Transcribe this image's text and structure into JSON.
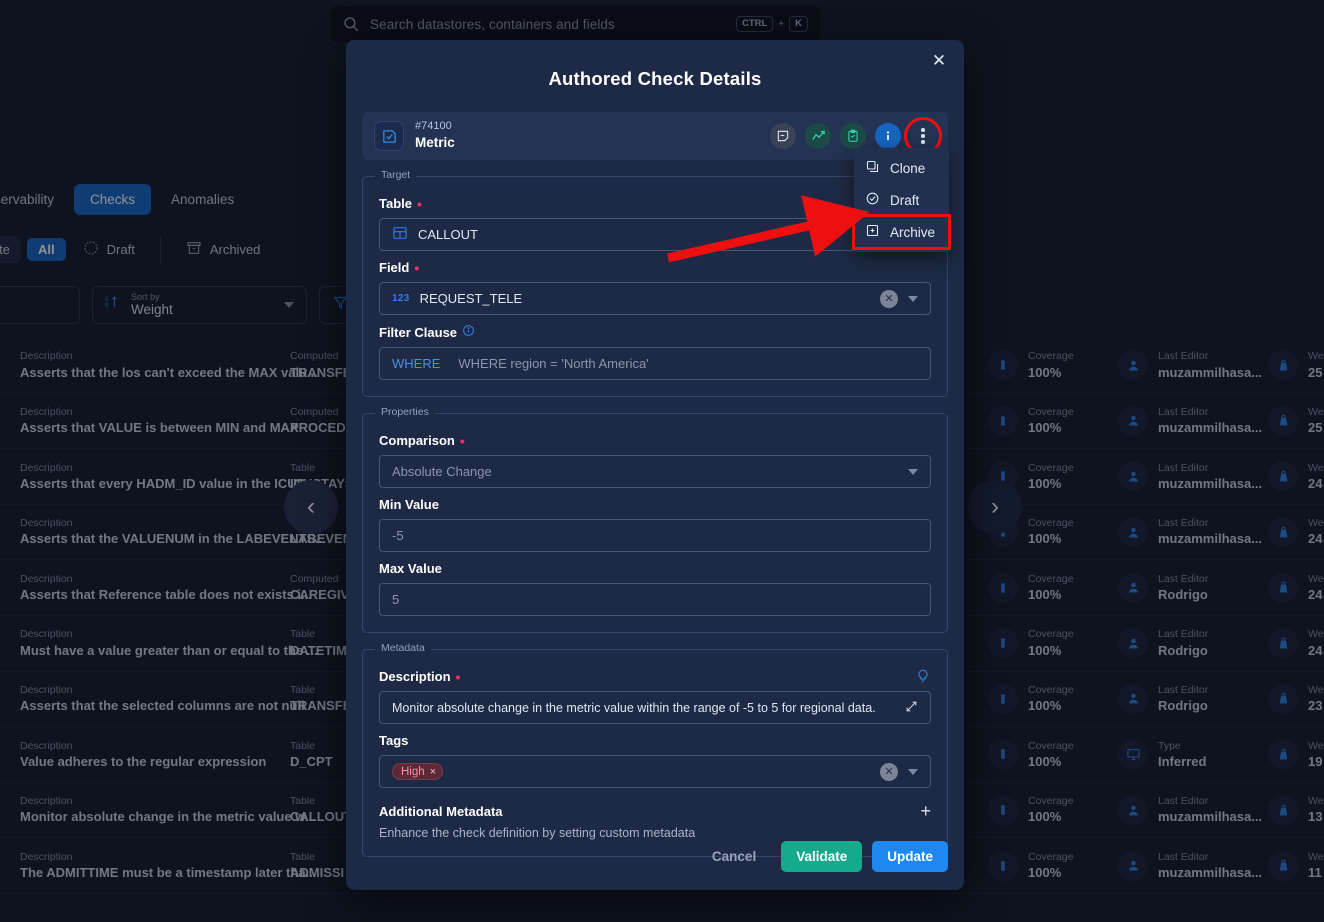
{
  "topbar": {
    "search_placeholder": "Search datastores, containers and fields",
    "kbd_ctrl": "CTRL",
    "kbd_plus": "+",
    "kbd_key": "K"
  },
  "nav": {
    "tabs": [
      {
        "label": "Observability",
        "active": false
      },
      {
        "label": "Checks",
        "active": true
      },
      {
        "label": "Anomalies",
        "active": false
      }
    ]
  },
  "filters": {
    "favorite": "avorite",
    "all": "All",
    "draft": "Draft",
    "archived": "Archived"
  },
  "controls": {
    "sort_label": "Sort by",
    "sort_value": "Weight"
  },
  "list": {
    "labels": {
      "description": "Description",
      "table": "Table",
      "computed": "Computed",
      "coverage": "Coverage",
      "last_editor": "Last Editor",
      "type": "Type",
      "weight": "Weight"
    },
    "rows": [
      {
        "desc": "Asserts that the los can't exceed the MAX valu...",
        "target_label": "Computed",
        "target": "TRANSFE",
        "coverage": "100%",
        "editor_label": "Last Editor",
        "editor": "muzammilhasa...",
        "editor_icon": "user-icon",
        "weight": "25"
      },
      {
        "desc": "Asserts that VALUE is between MIN and MAX",
        "target_label": "Computed",
        "target": "PROCEDU",
        "coverage": "100%",
        "editor_label": "Last Editor",
        "editor": "muzammilhasa...",
        "editor_icon": "user-icon",
        "weight": "25"
      },
      {
        "desc": "Asserts that every HADM_ID value in the ICUS...",
        "target_label": "Table",
        "target": "ICUSTAYS",
        "coverage": "100%",
        "editor_label": "Last Editor",
        "editor": "muzammilhasa...",
        "editor_icon": "user-icon",
        "weight": "24"
      },
      {
        "desc": "Asserts that the VALUENUM in the LABEVENTS...",
        "target_label": "Table",
        "target": "LABEVEN",
        "coverage": "100%",
        "editor_label": "Last Editor",
        "editor": "muzammilhasa...",
        "editor_icon": "user-icon",
        "weight": "24"
      },
      {
        "desc": "Asserts that Reference table does not exists i...",
        "target_label": "Computed",
        "target": "CAREGIV",
        "coverage": "100%",
        "editor_label": "Last Editor",
        "editor": "Rodrigo",
        "editor_icon": "user-icon",
        "weight": "24"
      },
      {
        "desc": "Must have a value greater than or equal to the ...",
        "target_label": "Table",
        "target": "DATETIM",
        "coverage": "100%",
        "editor_label": "Last Editor",
        "editor": "Rodrigo",
        "editor_icon": "user-icon",
        "weight": "24"
      },
      {
        "desc": "Asserts that the selected columns are not null",
        "target_label": "Table",
        "target": "TRANSFE",
        "coverage": "100%",
        "editor_label": "Last Editor",
        "editor": "Rodrigo",
        "editor_icon": "user-icon",
        "weight": "23"
      },
      {
        "desc": "Value adheres to the regular expression",
        "target_label": "Table",
        "target": "D_CPT",
        "coverage": "100%",
        "editor_label": "Type",
        "editor": "Inferred",
        "editor_icon": "monitor-icon",
        "weight": "19"
      },
      {
        "desc": "Monitor absolute change in the metric value w...",
        "target_label": "Table",
        "target": "CALLOUT",
        "coverage": "100%",
        "editor_label": "Last Editor",
        "editor": "muzammilhasa...",
        "editor_icon": "user-icon",
        "weight": "13"
      },
      {
        "desc": "The ADMITTIME must be a timestamp later tha...",
        "target_label": "Table",
        "target": "ADMISSI",
        "coverage": "100%",
        "editor_label": "Last Editor",
        "editor": "muzammilhasa...",
        "editor_icon": "user-icon",
        "weight": "11"
      }
    ]
  },
  "pager": {
    "prev": "‹",
    "next": "›"
  },
  "modal": {
    "title": "Authored Check Details",
    "close": "✕",
    "check": {
      "id": "#74100",
      "type": "Metric",
      "actions": [
        {
          "name": "note-icon",
          "style": "gray"
        },
        {
          "name": "trend-chart-icon",
          "style": "teal"
        },
        {
          "name": "clipboard-check-icon",
          "style": "teal"
        },
        {
          "name": "info-icon",
          "style": "blue"
        }
      ]
    },
    "dropdown": {
      "items": [
        {
          "label": "Clone",
          "icon": "clone-icon",
          "highlighted": false
        },
        {
          "label": "Draft",
          "icon": "draft-check-icon",
          "highlighted": false
        },
        {
          "label": "Archive",
          "icon": "archive-icon",
          "highlighted": true
        }
      ]
    },
    "target": {
      "legend": "Target",
      "table_label": "Table",
      "table_value": "CALLOUT",
      "field_label": "Field",
      "field_value": "REQUEST_TELE",
      "field_type_icon": "123",
      "filter_label": "Filter Clause",
      "filter_kw": "WHERE",
      "filter_placeholder": "WHERE region = 'North America'"
    },
    "properties": {
      "legend": "Properties",
      "comparison_label": "Comparison",
      "comparison_value": "Absolute Change",
      "min_label": "Min Value",
      "min_value": "-5",
      "max_label": "Max Value",
      "max_value": "5"
    },
    "metadata": {
      "legend": "Metadata",
      "description_label": "Description",
      "description_value": "Monitor absolute change in the metric value within the range of -5 to 5 for regional data.",
      "tags_label": "Tags",
      "tag": "High",
      "tag_remove": "×",
      "additional_title": "Additional Metadata",
      "additional_sub": "Enhance the check definition by setting custom metadata",
      "add_plus": "+"
    },
    "footer": {
      "cancel": "Cancel",
      "validate": "Validate",
      "update": "Update"
    }
  },
  "annotation": {
    "arrow_color": "#ee1010",
    "highlight_color": "#ee1010"
  }
}
